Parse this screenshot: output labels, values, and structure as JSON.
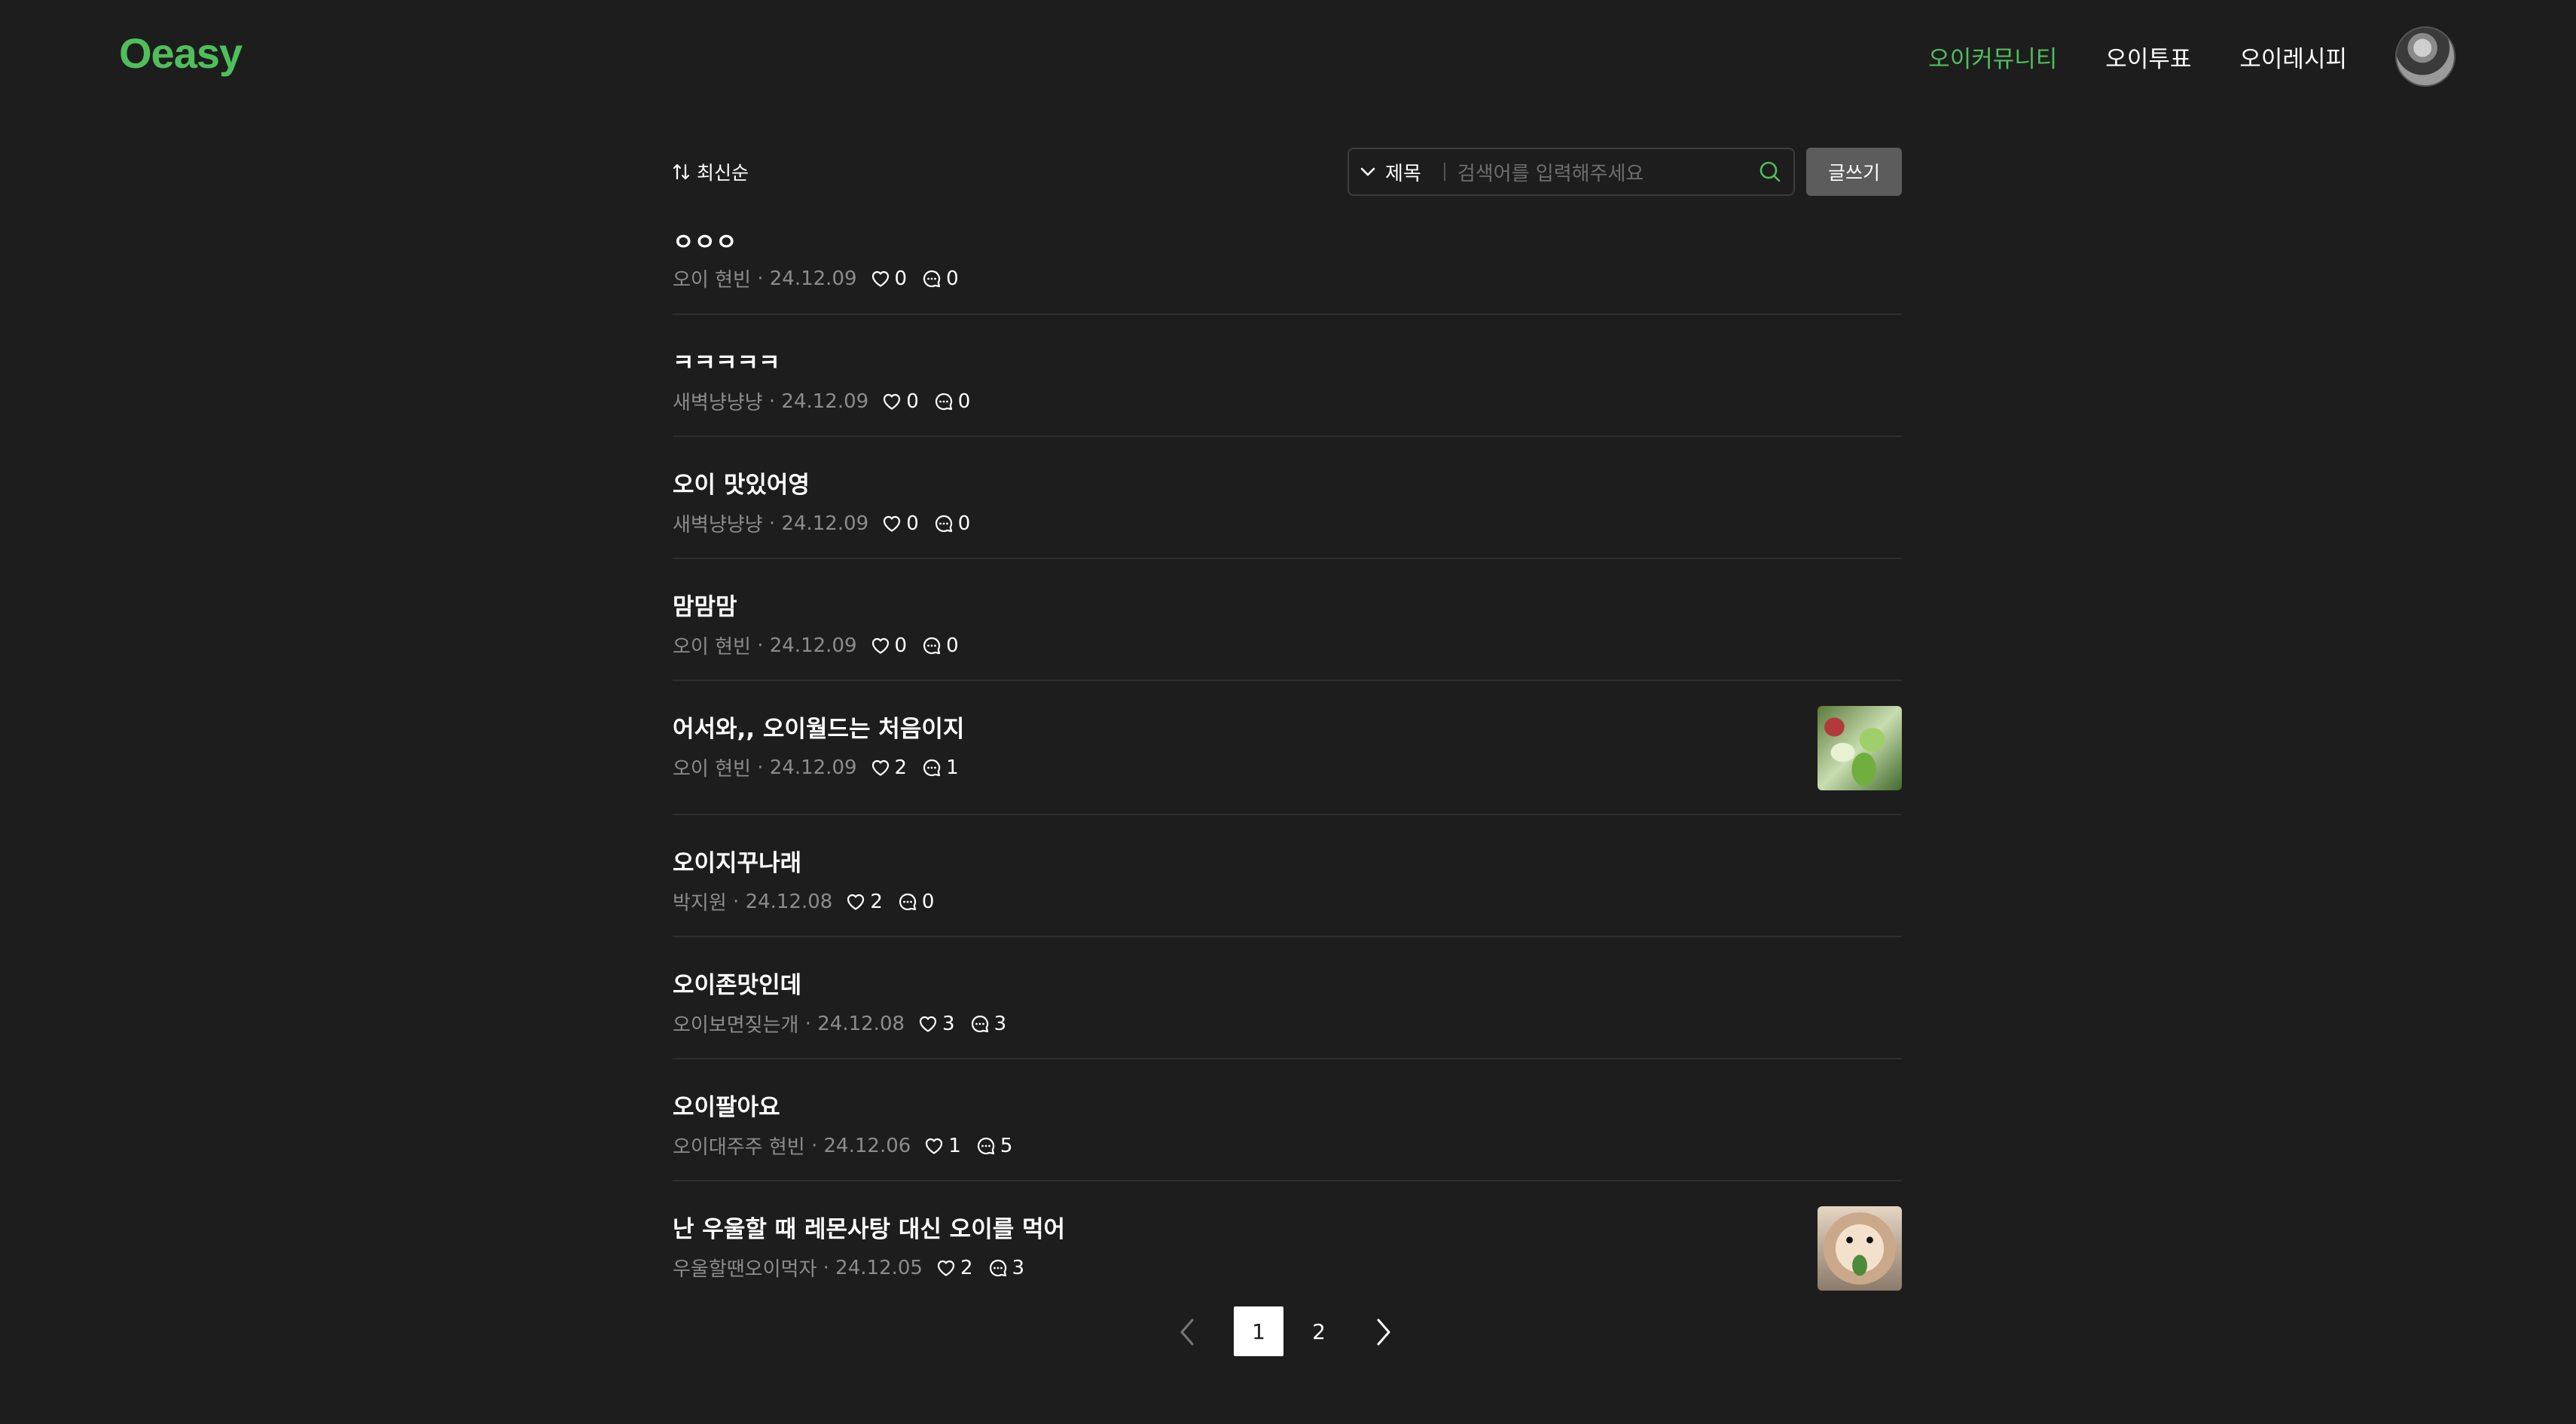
{
  "header": {
    "logo": "Oeasy",
    "nav": [
      "오이커뮤니티",
      "오이투표",
      "오이레시피"
    ],
    "active_nav": "오이커뮤니티"
  },
  "toolbar": {
    "sort_label": "최신순",
    "search_field": "제목",
    "search_placeholder": "검색어를 입력해주세요",
    "write_label": "글쓰기"
  },
  "posts": [
    {
      "title": "ㅇㅇㅇ",
      "author": "오이 현빈",
      "date": "24.12.09",
      "likes": "0",
      "comments": "0"
    },
    {
      "title": "ㅋㅋㅋㅋㅋ",
      "author": "새벽냥냥냥",
      "date": "24.12.09",
      "likes": "0",
      "comments": "0"
    },
    {
      "title": "오이 맛있어영",
      "author": "새벽냥냥냥",
      "date": "24.12.09",
      "likes": "0",
      "comments": "0"
    },
    {
      "title": "맘맘맘",
      "author": "오이 현빈",
      "date": "24.12.09",
      "likes": "0",
      "comments": "0"
    },
    {
      "title": "어서와,, 오이월드는 처음이지",
      "author": "오이 현빈",
      "date": "24.12.09",
      "likes": "2",
      "comments": "1"
    },
    {
      "title": "오이지꾸나래",
      "author": "박지원",
      "date": "24.12.08",
      "likes": "2",
      "comments": "0"
    },
    {
      "title": "오이존맛인데",
      "author": "오이보면짖는개",
      "date": "24.12.08",
      "likes": "3",
      "comments": "3"
    },
    {
      "title": "오이팔아요",
      "author": "오이대주주 현빈",
      "date": "24.12.06",
      "likes": "1",
      "comments": "5"
    },
    {
      "title": "난 우울할 때 레몬사탕 대신 오이를 먹어",
      "author": "우울할땐오이먹자",
      "date": "24.12.05",
      "likes": "2",
      "comments": "3"
    }
  ],
  "pagination": {
    "current": "1",
    "other": "2"
  },
  "colors": {
    "accent": "#4fbf5b",
    "background": "#1d1d1d"
  }
}
